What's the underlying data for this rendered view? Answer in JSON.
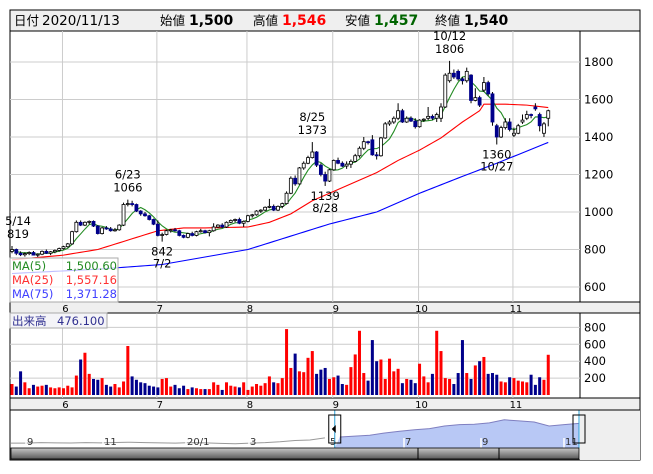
{
  "header": {
    "date_label": "日付",
    "date_value": "2020/11/13",
    "open_label": "始値",
    "open_value": "1,500",
    "high_label": "高値",
    "high_value": "1,546",
    "low_label": "安値",
    "low_value": "1,457",
    "close_label": "終値",
    "close_value": "1,540"
  },
  "legend": {
    "ma5_label": "MA(5)",
    "ma5_value": "1,500.60",
    "ma25_label": "MA(25)",
    "ma25_value": "1,557.16",
    "ma75_label": "MA(75)",
    "ma75_value": "1,371.28",
    "volume_label": "出来高",
    "volume_value": "476.100"
  },
  "colors": {
    "up_fill": "#ffffff",
    "down_fill": "#00008b",
    "ma5": "#228b22",
    "ma25": "#ff0000",
    "ma75": "#0000ff",
    "vol_up": "#ff0000",
    "vol_down": "#00008b",
    "vol_flat": "#999999",
    "high": "#ff0000",
    "low": "#006400",
    "nav_fill": "#b8c8f5",
    "nav_line": "#7f7fc0"
  },
  "chart_data": {
    "type": "candlestick",
    "price_axis": {
      "ylim": [
        520,
        1940
      ],
      "ticks": [
        600,
        800,
        1000,
        1200,
        1400,
        1600,
        1800
      ]
    },
    "month_ticks": [
      {
        "label": "6",
        "index": 12
      },
      {
        "label": "7",
        "index": 34
      },
      {
        "label": "8",
        "index": 55
      },
      {
        "label": "9",
        "index": 75
      },
      {
        "label": "10",
        "index": 95
      },
      {
        "label": "11",
        "index": 117
      }
    ],
    "annotations": [
      {
        "top": "5/14",
        "bottom": "819",
        "index": 0,
        "price": 819,
        "pos": "above"
      },
      {
        "top": "6/23",
        "bottom": "1066",
        "index": 27,
        "price": 1066,
        "pos": "above"
      },
      {
        "top": "842",
        "bottom": "7/2",
        "index": 35,
        "price": 842,
        "pos": "below"
      },
      {
        "top": "8/25",
        "bottom": "1373",
        "index": 70,
        "price": 1373,
        "pos": "above"
      },
      {
        "top": "1139",
        "bottom": "8/28",
        "index": 73,
        "price": 1139,
        "pos": "below"
      },
      {
        "top": "10/12",
        "bottom": "1806",
        "index": 102,
        "price": 1806,
        "pos": "above"
      },
      {
        "top": "1360",
        "bottom": "10/27",
        "index": 113,
        "price": 1360,
        "pos": "below"
      }
    ],
    "ohlc": [
      [
        790,
        819,
        780,
        800
      ],
      [
        800,
        805,
        770,
        780
      ],
      [
        780,
        790,
        765,
        772
      ],
      [
        772,
        785,
        762,
        778
      ],
      [
        778,
        790,
        770,
        784
      ],
      [
        784,
        792,
        768,
        770
      ],
      [
        770,
        780,
        760,
        775
      ],
      [
        775,
        795,
        770,
        790
      ],
      [
        790,
        800,
        776,
        780
      ],
      [
        780,
        792,
        770,
        788
      ],
      [
        788,
        800,
        780,
        795
      ],
      [
        795,
        810,
        788,
        805
      ],
      [
        805,
        820,
        800,
        815
      ],
      [
        815,
        835,
        810,
        830
      ],
      [
        830,
        900,
        825,
        895
      ],
      [
        895,
        955,
        890,
        945
      ],
      [
        945,
        955,
        925,
        930
      ],
      [
        930,
        950,
        925,
        945
      ],
      [
        945,
        955,
        935,
        950
      ],
      [
        950,
        955,
        920,
        925
      ],
      [
        925,
        930,
        880,
        885
      ],
      [
        885,
        920,
        880,
        915
      ],
      [
        915,
        925,
        905,
        910
      ],
      [
        910,
        920,
        895,
        900
      ],
      [
        900,
        915,
        895,
        905
      ],
      [
        905,
        935,
        900,
        930
      ],
      [
        930,
        1050,
        925,
        1040
      ],
      [
        1040,
        1066,
        1030,
        1045
      ],
      [
        1045,
        1060,
        1030,
        1040
      ],
      [
        1040,
        1045,
        1000,
        1005
      ],
      [
        1005,
        1010,
        980,
        990
      ],
      [
        990,
        1000,
        975,
        980
      ],
      [
        980,
        985,
        955,
        960
      ],
      [
        960,
        965,
        930,
        935
      ],
      [
        935,
        955,
        870,
        875
      ],
      [
        875,
        890,
        842,
        880
      ],
      [
        880,
        905,
        875,
        900
      ],
      [
        900,
        910,
        890,
        905
      ],
      [
        905,
        915,
        895,
        900
      ],
      [
        900,
        905,
        870,
        875
      ],
      [
        875,
        880,
        860,
        865
      ],
      [
        865,
        890,
        860,
        885
      ],
      [
        885,
        895,
        870,
        875
      ],
      [
        875,
        900,
        870,
        895
      ],
      [
        895,
        910,
        890,
        900
      ],
      [
        900,
        905,
        885,
        890
      ],
      [
        890,
        905,
        870,
        900
      ],
      [
        900,
        940,
        895,
        920
      ],
      [
        920,
        935,
        915,
        930
      ],
      [
        930,
        940,
        915,
        920
      ],
      [
        920,
        950,
        915,
        945
      ],
      [
        945,
        960,
        940,
        955
      ],
      [
        955,
        965,
        945,
        960
      ],
      [
        960,
        970,
        935,
        940
      ],
      [
        940,
        955,
        920,
        950
      ],
      [
        950,
        985,
        945,
        980
      ],
      [
        980,
        990,
        970,
        985
      ],
      [
        985,
        1010,
        980,
        1005
      ],
      [
        1005,
        1015,
        995,
        1010
      ],
      [
        1010,
        1030,
        1005,
        1025
      ],
      [
        1025,
        1070,
        1020,
        1030
      ],
      [
        1030,
        1040,
        1005,
        1010
      ],
      [
        1010,
        1035,
        1005,
        1030
      ],
      [
        1030,
        1050,
        1020,
        1045
      ],
      [
        1045,
        1110,
        1040,
        1100
      ],
      [
        1100,
        1190,
        1095,
        1180
      ],
      [
        1180,
        1195,
        1140,
        1150
      ],
      [
        1150,
        1240,
        1145,
        1235
      ],
      [
        1235,
        1270,
        1225,
        1260
      ],
      [
        1260,
        1300,
        1255,
        1290
      ],
      [
        1290,
        1373,
        1285,
        1320
      ],
      [
        1320,
        1325,
        1240,
        1250
      ],
      [
        1250,
        1260,
        1190,
        1200
      ],
      [
        1200,
        1215,
        1139,
        1165
      ],
      [
        1165,
        1230,
        1160,
        1225
      ],
      [
        1225,
        1280,
        1220,
        1275
      ],
      [
        1275,
        1290,
        1255,
        1260
      ],
      [
        1260,
        1270,
        1240,
        1245
      ],
      [
        1245,
        1270,
        1230,
        1255
      ],
      [
        1255,
        1280,
        1235,
        1270
      ],
      [
        1270,
        1310,
        1265,
        1300
      ],
      [
        1300,
        1350,
        1290,
        1340
      ],
      [
        1340,
        1400,
        1330,
        1375
      ],
      [
        1375,
        1380,
        1360,
        1370
      ],
      [
        1385,
        1410,
        1300,
        1305
      ],
      [
        1305,
        1320,
        1280,
        1300
      ],
      [
        1300,
        1400,
        1295,
        1395
      ],
      [
        1395,
        1480,
        1390,
        1470
      ],
      [
        1470,
        1490,
        1460,
        1480
      ],
      [
        1480,
        1510,
        1470,
        1500
      ],
      [
        1500,
        1580,
        1490,
        1540
      ],
      [
        1540,
        1550,
        1475,
        1480
      ],
      [
        1480,
        1510,
        1475,
        1500
      ],
      [
        1500,
        1510,
        1480,
        1485
      ],
      [
        1485,
        1500,
        1445,
        1455
      ],
      [
        1455,
        1495,
        1450,
        1490
      ],
      [
        1490,
        1500,
        1480,
        1495
      ],
      [
        1500,
        1560,
        1490,
        1510
      ],
      [
        1510,
        1520,
        1490,
        1500
      ],
      [
        1500,
        1530,
        1480,
        1520
      ],
      [
        1500,
        1580,
        1480,
        1560
      ],
      [
        1560,
        1740,
        1555,
        1730
      ],
      [
        1700,
        1806,
        1690,
        1740
      ],
      [
        1740,
        1760,
        1710,
        1720
      ],
      [
        1750,
        1760,
        1700,
        1710
      ],
      [
        1710,
        1720,
        1680,
        1700
      ],
      [
        1700,
        1770,
        1690,
        1750
      ],
      [
        1730,
        1735,
        1580,
        1595
      ],
      [
        1595,
        1660,
        1590,
        1610
      ],
      [
        1610,
        1620,
        1560,
        1570
      ],
      [
        1650,
        1720,
        1640,
        1690
      ],
      [
        1690,
        1700,
        1620,
        1630
      ],
      [
        1630,
        1640,
        1460,
        1480
      ],
      [
        1460,
        1470,
        1360,
        1400
      ],
      [
        1400,
        1460,
        1395,
        1450
      ],
      [
        1450,
        1500,
        1440,
        1480
      ],
      [
        1480,
        1500,
        1430,
        1440
      ],
      [
        1410,
        1450,
        1400,
        1420
      ],
      [
        1420,
        1470,
        1415,
        1460
      ],
      [
        1480,
        1520,
        1470,
        1490
      ],
      [
        1500,
        1540,
        1490,
        1520
      ],
      [
        1520,
        1525,
        1500,
        1515
      ],
      [
        1560,
        1580,
        1540,
        1550
      ],
      [
        1520,
        1530,
        1430,
        1460
      ],
      [
        1420,
        1480,
        1400,
        1470
      ],
      [
        1500,
        1546,
        1457,
        1540
      ]
    ],
    "ma25_points": [
      [
        0,
        745
      ],
      [
        12,
        770
      ],
      [
        20,
        800
      ],
      [
        27,
        850
      ],
      [
        34,
        900
      ],
      [
        40,
        915
      ],
      [
        45,
        915
      ],
      [
        55,
        920
      ],
      [
        60,
        945
      ],
      [
        65,
        990
      ],
      [
        70,
        1060
      ],
      [
        75,
        1110
      ],
      [
        80,
        1160
      ],
      [
        85,
        1210
      ],
      [
        90,
        1275
      ],
      [
        95,
        1330
      ],
      [
        100,
        1395
      ],
      [
        105,
        1480
      ],
      [
        109,
        1540
      ],
      [
        110,
        1575
      ],
      [
        115,
        1575
      ],
      [
        120,
        1570
      ],
      [
        125,
        1557
      ]
    ],
    "ma75_points": [
      [
        0,
        672
      ],
      [
        20,
        695
      ],
      [
        35,
        720
      ],
      [
        55,
        800
      ],
      [
        74,
        936
      ],
      [
        85,
        1000
      ],
      [
        95,
        1100
      ],
      [
        105,
        1190
      ],
      [
        113,
        1260
      ],
      [
        125,
        1371
      ]
    ],
    "volume": {
      "ylim": [
        0,
        860
      ],
      "ticks": [
        200,
        400,
        600,
        800
      ],
      "values": [
        130,
        100,
        280,
        150,
        80,
        120,
        100,
        110,
        120,
        90,
        80,
        90,
        80,
        110,
        90,
        230,
        420,
        500,
        250,
        190,
        180,
        200,
        120,
        100,
        130,
        90,
        160,
        580,
        220,
        180,
        150,
        140,
        110,
        100,
        90,
        190,
        200,
        100,
        120,
        80,
        110,
        70,
        90,
        80,
        70,
        70,
        70,
        150,
        120,
        60,
        150,
        110,
        100,
        90,
        150,
        60,
        100,
        130,
        110,
        140,
        220,
        150,
        140,
        200,
        780,
        320,
        490,
        280,
        270,
        440,
        520,
        250,
        300,
        320,
        190,
        210,
        230,
        130,
        120,
        330,
        480,
        760,
        260,
        170,
        650,
        400,
        420,
        190,
        430,
        280,
        310,
        140,
        190,
        180,
        140,
        370,
        220,
        150,
        250,
        760,
        520,
        200,
        190,
        130,
        260,
        650,
        260,
        190,
        350,
        400,
        450,
        250,
        260,
        240,
        160,
        150,
        210,
        200,
        170,
        160,
        150,
        240,
        120,
        210,
        180,
        476
      ]
    },
    "navigator": {
      "ticks": [
        {
          "label": "9",
          "x": 30
        },
        {
          "label": "11",
          "x": 107
        },
        {
          "label": "20/1",
          "x": 190
        },
        {
          "label": "3",
          "x": 253
        },
        {
          "label": "5",
          "x": 333
        },
        {
          "label": "7",
          "x": 408
        },
        {
          "label": "9",
          "x": 485
        },
        {
          "label": "11",
          "x": 568
        }
      ],
      "values": [
        640,
        642,
        660,
        650,
        648,
        662,
        652,
        668,
        680,
        662,
        650,
        640,
        660,
        650,
        630,
        610,
        640,
        660,
        700,
        760,
        780,
        880,
        920,
        960,
        1000,
        1100,
        1180,
        1250,
        1300,
        1420,
        1480,
        1500,
        1560,
        1700,
        1650,
        1600,
        1420,
        1480,
        1540
      ],
      "selected_fraction": [
        0.57,
        1.0
      ]
    }
  }
}
